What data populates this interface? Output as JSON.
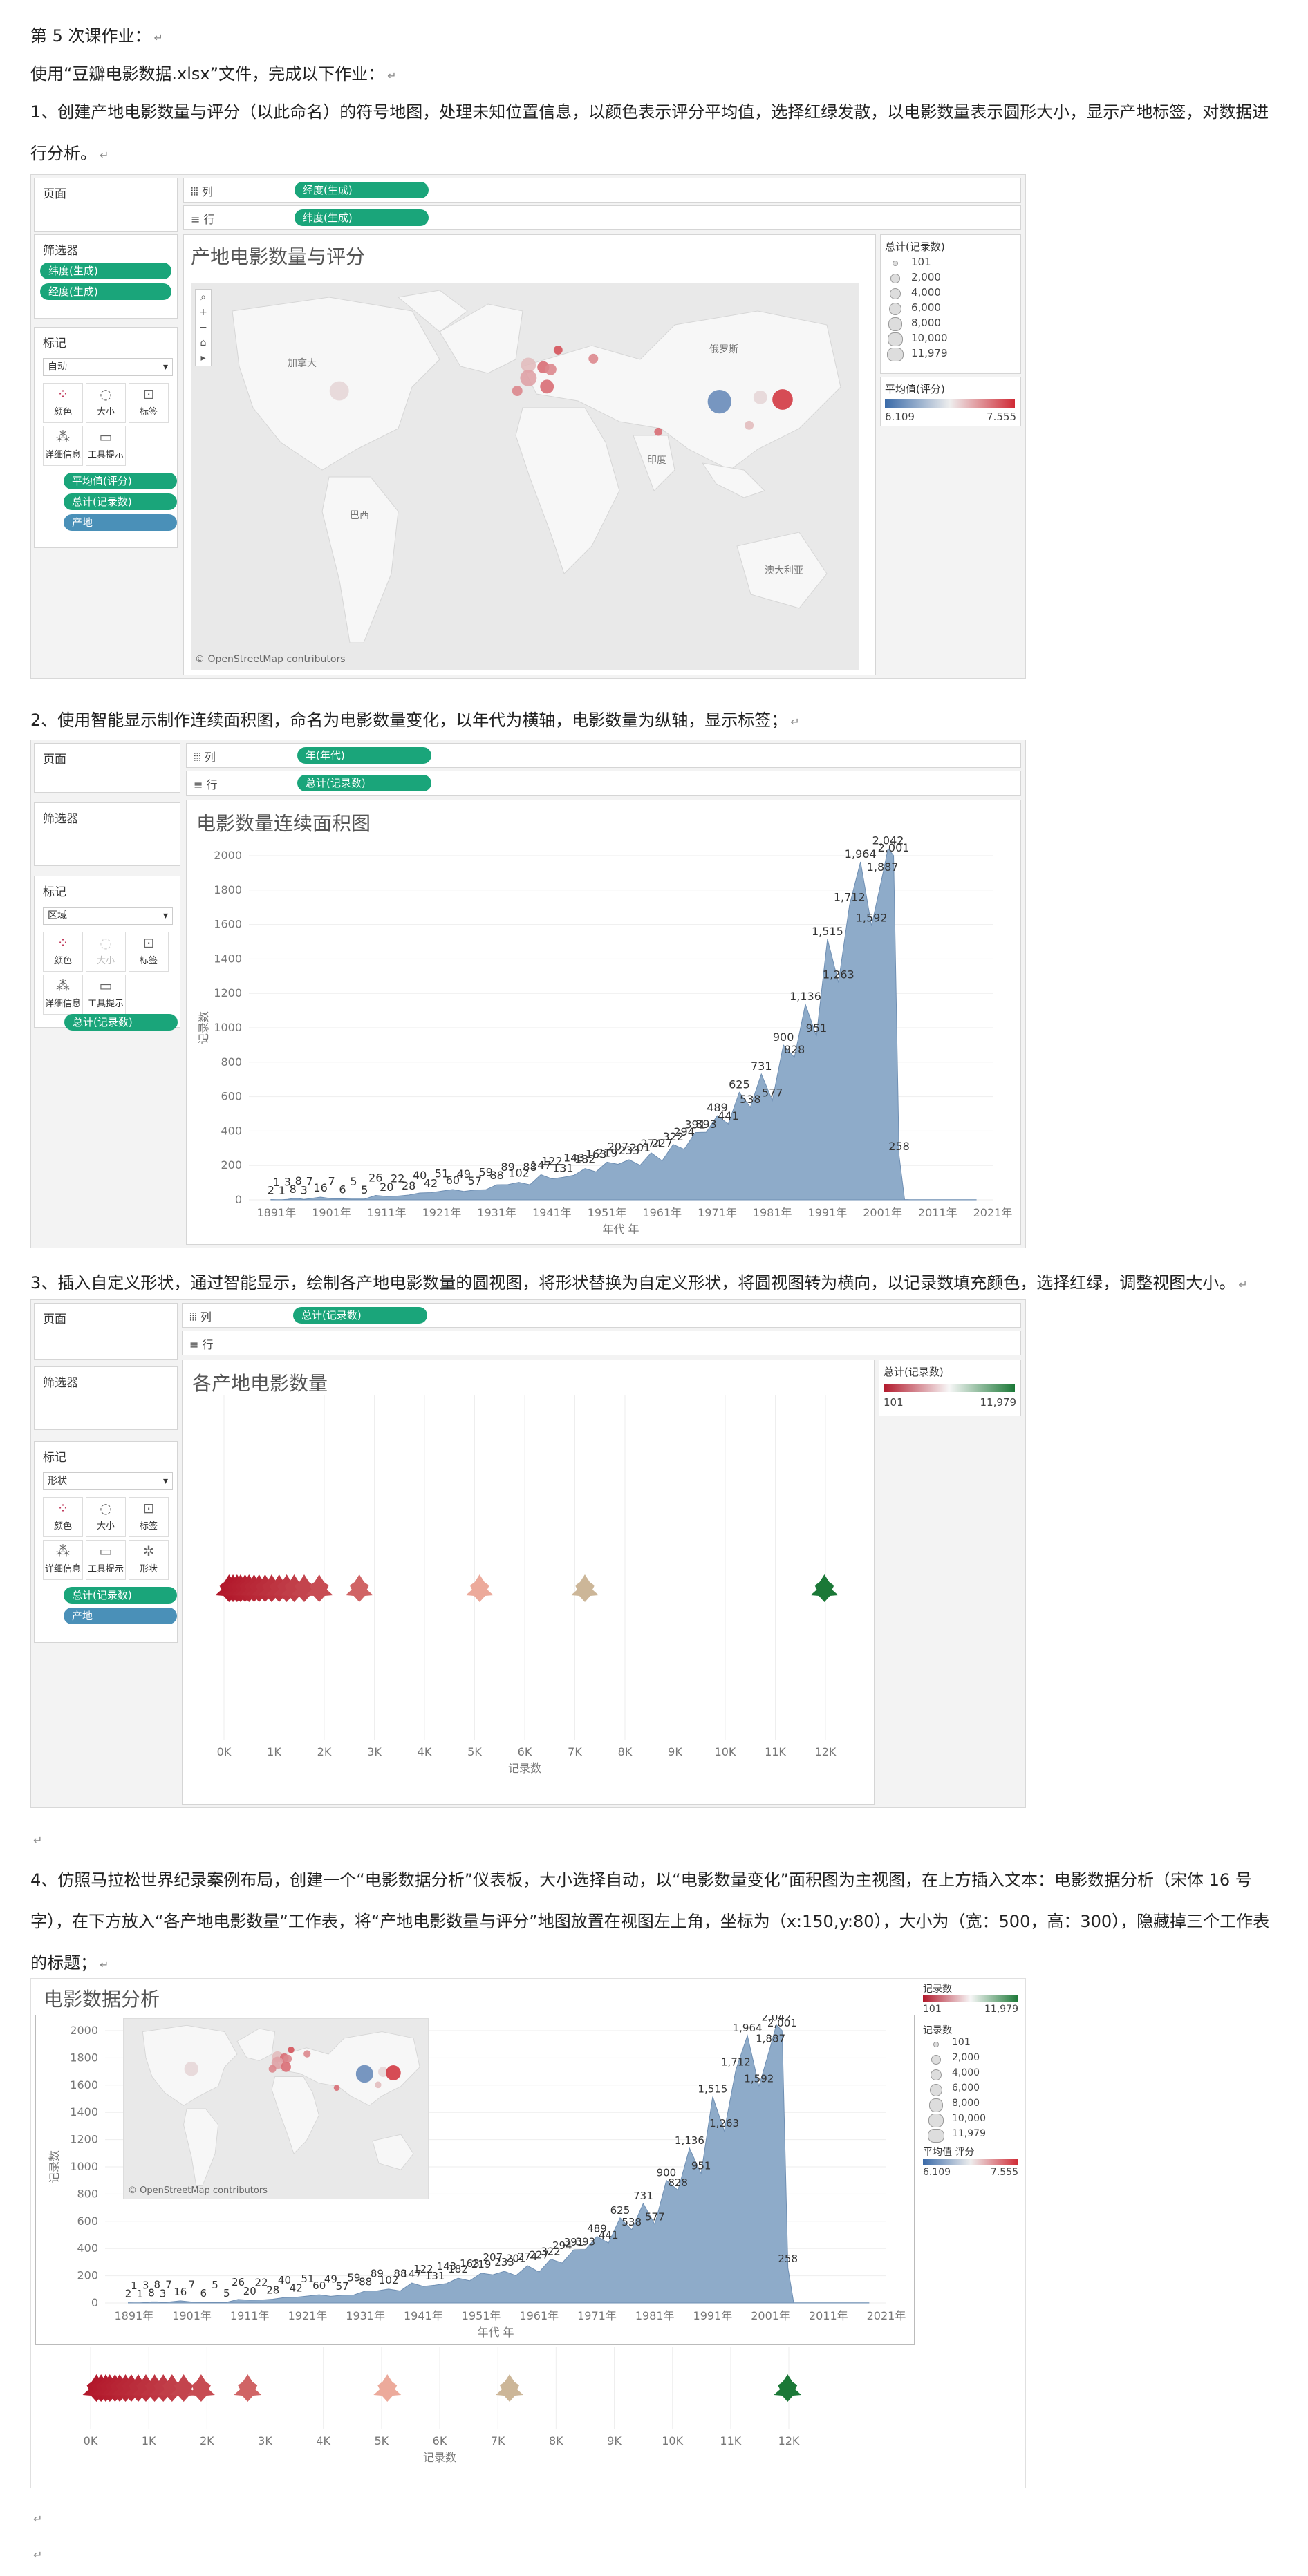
{
  "doc": {
    "title": "第 5 次课作业：",
    "intro": "使用“豆瓣电影数据.xlsx”文件，完成以下作业：",
    "task1": "1、创建产地电影数量与评分（以此命名）的符号地图，处理未知位置信息，以颜色表示评分平均值，选择红绿发散，以电影数量表示圆形大小，显示产地标签，对数据进行分析。",
    "task2": "2、使用智能显示制作连续面积图，命名为电影数量变化，以年代为横轴，电影数量为纵轴，显示标签；",
    "task3": "3、插入自定义形状，通过智能显示，绘制各产地电影数量的圆视图，将形状替换为自定义形状，将圆视图转为横向，以记录数填充颜色，选择红绿，调整视图大小。",
    "task4": "4、仿照马拉松世界纪录案例布局，创建一个“电影数据分析”仪表板，大小选择自动，以“电影数量变化”面积图为主视图，在上方插入文本：电影数据分析（宋体 16 号字），在下方放入“各产地电影数量”工作表，将“产地电影数量与评分”地图放置在视图左上角，坐标为（x:150,y:80），大小为（宽：500，高：300），隐藏掉三个工作表的标题；",
    "return_mark": "↵"
  },
  "ui": {
    "pages": "页面",
    "filters": "筛选器",
    "marks": "标记",
    "columns": "列",
    "rows": "行",
    "color": "颜色",
    "size": "大小",
    "label": "标签",
    "detail": "详细信息",
    "tooltip": "工具提示",
    "shape": "形状"
  },
  "map_sheet": {
    "col_pill": "经度(生成)",
    "row_pill": "纬度(生成)",
    "filter_pills": [
      "纬度(生成)",
      "经度(生成)"
    ],
    "mark_type": "自动",
    "mark_pills": [
      "平均值(评分)",
      "总计(记录数)",
      "产地"
    ],
    "title": "产地电影数量与评分",
    "osm": "© OpenStreetMap contributors",
    "place_labels": [
      "加拿大",
      "俄罗斯",
      "印度",
      "巴西",
      "澳大利亚"
    ],
    "size_legend_title": "总计(记录数)",
    "size_legend": [
      "101",
      "2,000",
      "4,000",
      "6,000",
      "8,000",
      "10,000",
      "11,979"
    ],
    "color_legend_title": "平均值(评分)",
    "color_min": "6.109",
    "color_max": "7.555"
  },
  "area_sheet": {
    "col_pill": "年(年代)",
    "row_pill": "总计(记录数)",
    "mark_type": "区域",
    "mark_pills": [
      "总计(记录数)"
    ],
    "title": "电影数量连续面积图"
  },
  "shape_sheet": {
    "col_pill": "总计(记录数)",
    "mark_type": "形状",
    "mark_pills": [
      "总计(记录数)",
      "产地"
    ],
    "title": "各产地电影数量",
    "legend_title": "总计(记录数)",
    "legend_min": "101",
    "legend_max": "11,979",
    "xlabel": "记录数",
    "ticks": [
      "0K",
      "1K",
      "2K",
      "3K",
      "4K",
      "5K",
      "6K",
      "7K",
      "8K",
      "9K",
      "10K",
      "11K",
      "12K"
    ]
  },
  "dashboard": {
    "title": "电影数据分析",
    "legend1_title": "记录数",
    "legend1_min": "101",
    "legend1_max": "11,979",
    "legend2_title": "记录数",
    "legend2": [
      "101",
      "2,000",
      "4,000",
      "6,000",
      "8,000",
      "10,000",
      "11,979"
    ],
    "legend3_title": "平均值 评分",
    "legend3_min": "6.109",
    "legend3_max": "7.555",
    "osm": "© OpenStreetMap contributors",
    "xlabel": "记录数"
  },
  "chart_data": [
    {
      "type": "area",
      "title": "",
      "xlabel": "年代 年",
      "ylabel": "记录数",
      "ylim": [
        0,
        2000
      ],
      "yticks": [
        0,
        200,
        400,
        600,
        800,
        1000,
        1200,
        1400,
        1600,
        1800,
        2000
      ],
      "xticks": [
        "1891年",
        "1901年",
        "1911年",
        "1921年",
        "1931年",
        "1941年",
        "1951年",
        "1961年",
        "1971年",
        "1981年",
        "1991年",
        "2001年",
        "2011年",
        "2021年"
      ],
      "x": [
        1890,
        1891,
        1892,
        1893,
        1894,
        1895,
        1896,
        1897,
        1899,
        1901,
        1903,
        1905,
        1907,
        1909,
        1911,
        1913,
        1915,
        1917,
        1919,
        1921,
        1923,
        1925,
        1927,
        1929,
        1931,
        1933,
        1935,
        1937,
        1939,
        1941,
        1943,
        1945,
        1947,
        1949,
        1951,
        1953,
        1955,
        1957,
        1959,
        1961,
        1963,
        1965,
        1967,
        1969,
        1971,
        1973,
        1975,
        1977,
        1979,
        1981,
        1983,
        1985,
        1987,
        1989,
        1991,
        1993,
        1995,
        1997,
        1999,
        2001,
        2002,
        2003,
        2004,
        2005,
        2006,
        2007,
        2008,
        2009,
        2010,
        2011,
        2012,
        2013,
        2014,
        2015,
        2016,
        2017,
        2018
      ],
      "values": [
        2,
        1,
        1,
        3,
        8,
        8,
        3,
        7,
        16,
        7,
        6,
        5,
        5,
        26,
        20,
        22,
        28,
        40,
        42,
        51,
        60,
        49,
        57,
        59,
        88,
        89,
        102,
        88,
        147,
        122,
        131,
        143,
        182,
        163,
        219,
        207,
        233,
        201,
        274,
        227,
        322,
        294,
        391,
        393,
        489,
        441,
        625,
        538,
        731,
        577,
        900,
        828,
        1136,
        951,
        1515,
        1263,
        1712,
        1964,
        1592,
        1887,
        2042,
        2001,
        258,
        2,
        1,
        1,
        1,
        1,
        1,
        1,
        1,
        1,
        1,
        1,
        1,
        1,
        1
      ],
      "labels": [
        "2",
        "1",
        "1",
        "3",
        "8",
        "8",
        "3",
        "7",
        "16",
        "7",
        "6",
        "5",
        "5",
        "26",
        "20",
        "22",
        "28",
        "40",
        "42",
        "51",
        "60",
        "49",
        "57",
        "59",
        "88",
        "89",
        "102",
        "88",
        "147",
        "122",
        "131",
        "143",
        "182",
        "163",
        "219",
        "207",
        "233",
        "201",
        "274",
        "227",
        "322",
        "294",
        "391",
        "393",
        "489",
        "441",
        "625",
        "538",
        "731",
        "577",
        "900",
        "828",
        "1,136",
        "951",
        "1,515",
        "1,263",
        "1,712",
        "1,964",
        "1,592",
        "1,887",
        "2,042",
        "2,001",
        "258"
      ]
    },
    {
      "type": "scatter",
      "title": "",
      "xlabel": "记录数",
      "xlim": [
        0,
        12000
      ],
      "values": [
        101,
        180,
        260,
        330,
        420,
        500,
        600,
        700,
        820,
        950,
        1100,
        1250,
        1400,
        1600,
        1900,
        2700,
        5100,
        7200,
        11979
      ]
    },
    {
      "type": "scatter",
      "title": "",
      "xlabel": "",
      "ylabel": "",
      "series": [
        {
          "points": [
            [
              -100,
              40,
              3000,
              6.9
            ],
            [
              2,
              52,
              1500,
              7.0
            ],
            [
              10,
              51,
              800,
              7.3
            ],
            [
              14,
              50,
              700,
              7.2
            ],
            [
              2,
              46,
              2000,
              7.1
            ],
            [
              12,
              42,
              1200,
              7.3
            ],
            [
              -4,
              40,
              500,
              7.2
            ],
            [
              18,
              59,
              300,
              7.4
            ],
            [
              105,
              35,
              5000,
              6.3
            ],
            [
              127,
              37,
              1200,
              6.9
            ],
            [
              139,
              36,
              3500,
              7.5
            ],
            [
              72,
              21,
              200,
              7.3
            ],
            [
              121,
              24,
              300,
              7.0
            ],
            [
              37,
              55,
              400,
              7.2
            ]
          ]
        }
      ]
    }
  ]
}
